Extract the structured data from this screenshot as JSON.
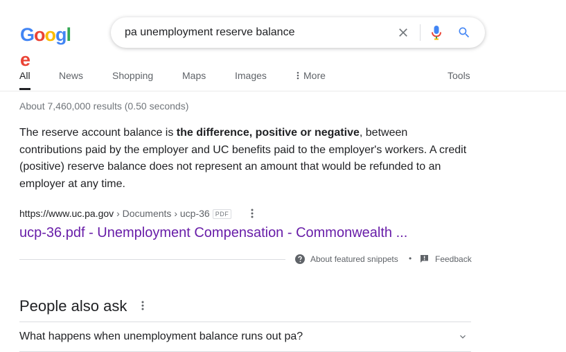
{
  "logo": {
    "text": "Google",
    "colors": [
      "#4285f4",
      "#ea4335",
      "#fbbc05",
      "#4285f4",
      "#34a853",
      "#ea4335"
    ]
  },
  "search": {
    "query": "pa unemployment reserve balance",
    "icons": [
      "close-icon",
      "mic-icon",
      "search-icon"
    ]
  },
  "tabs": [
    {
      "label": "All",
      "active": true
    },
    {
      "label": "News"
    },
    {
      "label": "Shopping"
    },
    {
      "label": "Maps"
    },
    {
      "label": "Images"
    },
    {
      "label": "More",
      "icon": "kebab-icon"
    },
    {
      "label": "Tools"
    }
  ],
  "stats": "About 7,460,000 results (0.50 seconds)",
  "snippet": {
    "before": "The reserve account balance is ",
    "bold": "the difference, positive or negative",
    "after": ", between contributions paid by the employer and UC benefits paid to the employer's workers. A credit (positive) reserve balance does not represent an amount that would be refunded to an employer at any time."
  },
  "result": {
    "url": "https://www.uc.pa.gov",
    "breadcrumb": " › Documents › ucp-36",
    "badge": "PDF",
    "title": "ucp-36.pdf - Unemployment Compensation - Commonwealth ..."
  },
  "featured": {
    "about_label": "About featured snippets",
    "separator": "•",
    "feedback_label": "Feedback"
  },
  "paa": {
    "title": "People also ask",
    "questions": [
      "What happens when unemployment balance runs out pa?"
    ]
  },
  "colors": {
    "link_visited": "#681da8",
    "text_primary": "#202124",
    "text_secondary": "#5f6368",
    "google_blue": "#4285f4"
  }
}
